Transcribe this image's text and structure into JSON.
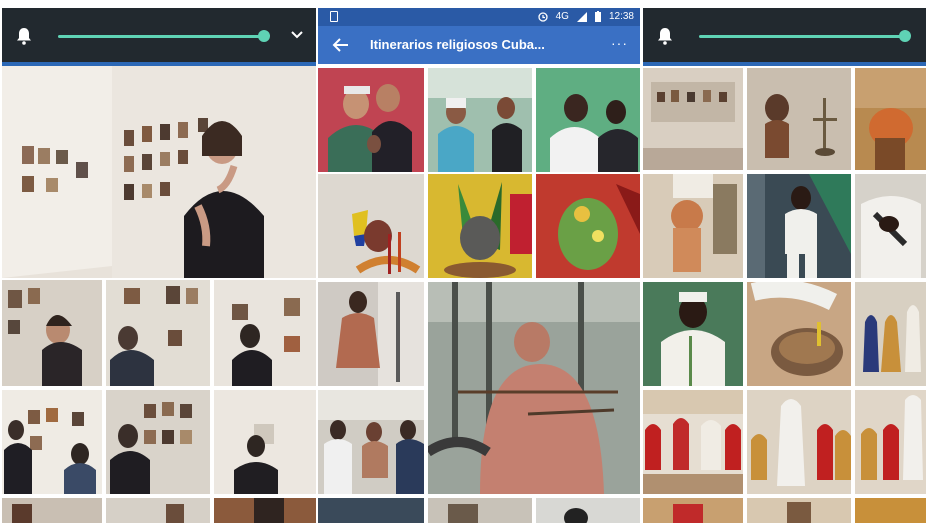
{
  "middle": {
    "status_time": "12:38",
    "status_net": "4G",
    "album_title": "Itinerarios religiosos Cuba...",
    "more_label": "···"
  },
  "colors": {
    "accent": "#5fd3b5",
    "appbar": "#3a70c4",
    "statusbar": "#2a5aa6",
    "volume_bar": "#22292f"
  },
  "icons": [
    "bell-icon",
    "chevron-down-icon",
    "back-arrow-icon",
    "more-icon",
    "alarm-icon",
    "signal-icon",
    "battery-icon"
  ]
}
